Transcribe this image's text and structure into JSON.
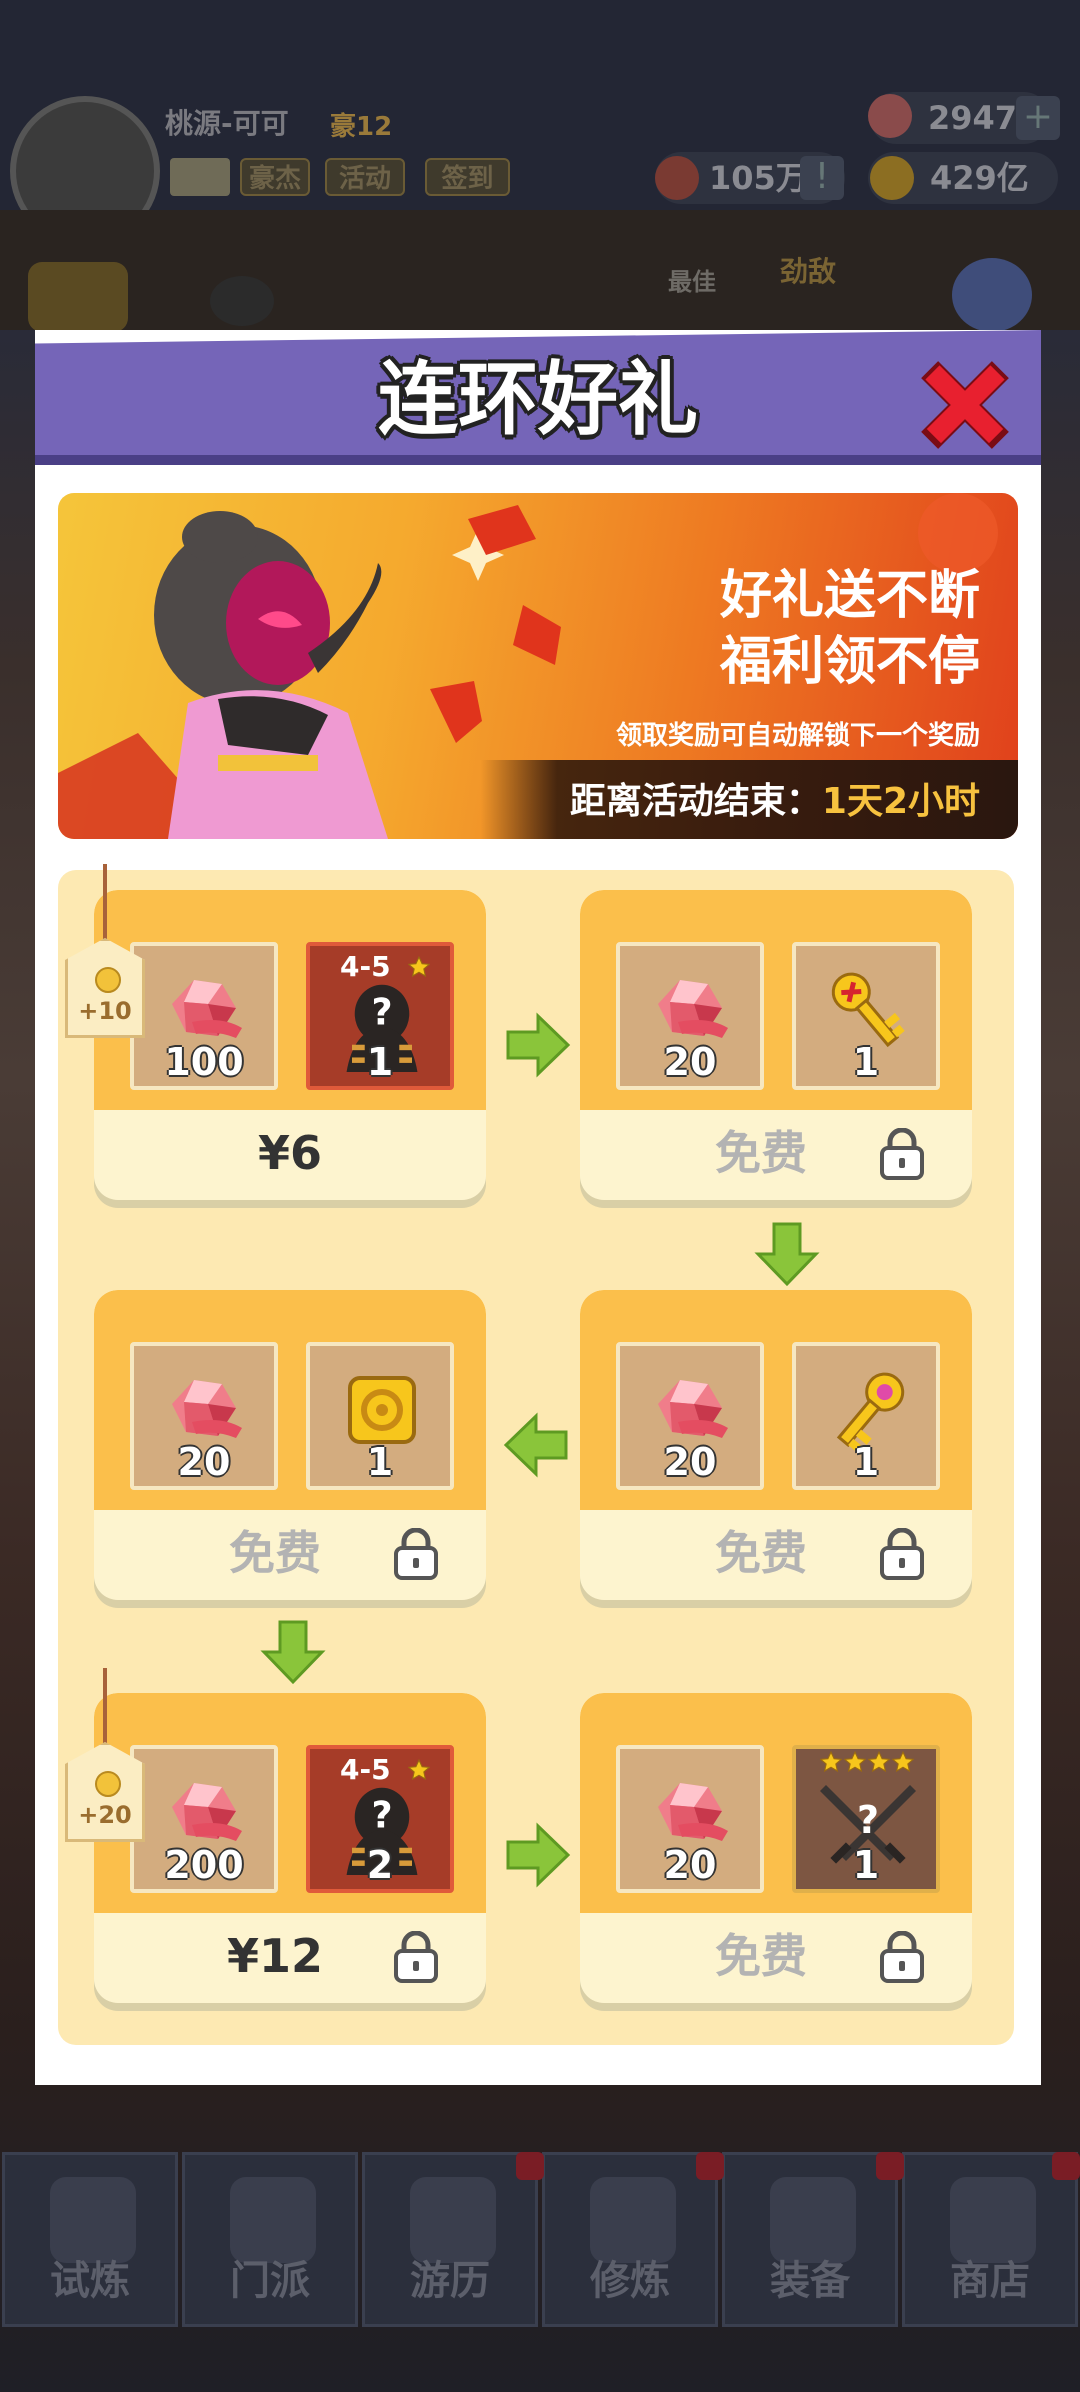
{
  "topbar": {
    "username": "桃源-可可",
    "vip": "豪12",
    "buttons": [
      "豪杰",
      "活动",
      "签到"
    ],
    "gems": "2947",
    "tickets": "105万",
    "gold": "429亿"
  },
  "subbar": {
    "best_label": "最佳",
    "rival_label": "劲敌"
  },
  "dialog": {
    "title": "连环好礼",
    "banner": {
      "line1": "好礼送不断",
      "line2": "福利领不停",
      "hint": "领取奖励可自动解锁下一个奖励",
      "countdown_label": "距离活动结束：",
      "countdown_value": "1天2小时"
    },
    "packs": [
      {
        "items": [
          {
            "icon": "gem-icon",
            "qty": "100"
          },
          {
            "icon": "mystery-hero-icon",
            "grade": "4-5",
            "qty": "1"
          }
        ],
        "price": "¥6",
        "tag": "+10"
      },
      {
        "items": [
          {
            "icon": "gem-icon",
            "qty": "20"
          },
          {
            "icon": "gold-key-icon",
            "qty": "1"
          }
        ],
        "price": "免费"
      },
      {
        "items": [
          {
            "icon": "gem-icon",
            "qty": "20"
          },
          {
            "icon": "gold-coin-tile-icon",
            "qty": "1"
          }
        ],
        "price": "免费"
      },
      {
        "items": [
          {
            "icon": "gem-icon",
            "qty": "20"
          },
          {
            "icon": "pink-key-icon",
            "qty": "1"
          }
        ],
        "price": "免费"
      },
      {
        "items": [
          {
            "icon": "gem-icon",
            "qty": "200"
          },
          {
            "icon": "mystery-hero-icon",
            "grade": "4-5",
            "qty": "2"
          }
        ],
        "price": "¥12",
        "tag": "+20"
      },
      {
        "items": [
          {
            "icon": "gem-icon",
            "qty": "20"
          },
          {
            "icon": "mystery-weapon-icon",
            "qty": "1"
          }
        ],
        "price": "免费"
      }
    ]
  },
  "nav": [
    "试炼",
    "门派",
    "游历",
    "修炼",
    "装备",
    "商店"
  ],
  "colors": {
    "header": "#7565b8",
    "card_top": "#fbbf4b",
    "card_bottom": "#fdf4cf",
    "grid_bg": "#fde9b2",
    "close": "#e8202f",
    "arrow": "#8ac53a"
  }
}
